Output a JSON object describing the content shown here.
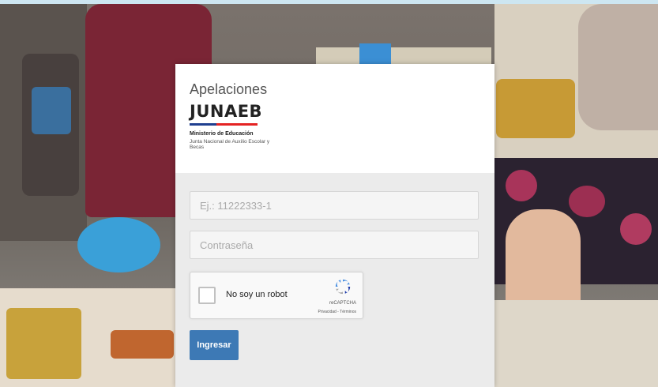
{
  "app": {
    "title": "Apelaciones"
  },
  "logo": {
    "name": "JUNAEB",
    "ministry": "Ministerio de Educación",
    "subtitle": "Junta Nacional de Auxilio Escolar y Becas",
    "bar_colors": [
      "#1f3f8f",
      "#e42323"
    ]
  },
  "form": {
    "rut_placeholder": "Ej.: 11222333-1",
    "rut_value": "",
    "password_placeholder": "Contraseña",
    "password_value": "",
    "submit_label": "Ingresar"
  },
  "captcha": {
    "label": "No soy un robot",
    "brand": "reCAPTCHA",
    "links": "Privacidad - Términos",
    "checked": false
  },
  "colors": {
    "accent": "#3d79b5",
    "panel_bg": "#ebebeb",
    "header_bg": "#ffffff"
  }
}
